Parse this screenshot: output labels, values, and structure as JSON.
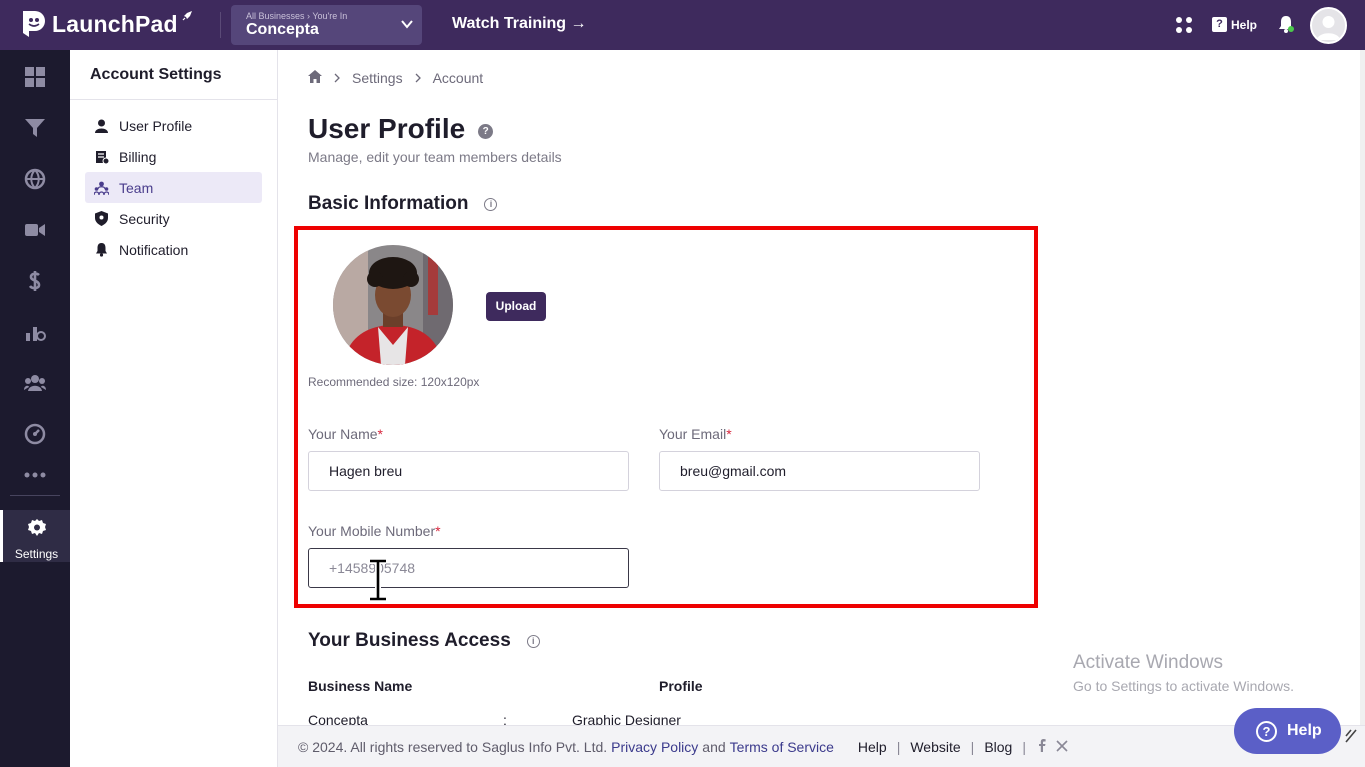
{
  "topbar": {
    "logo_text": "LaunchPad",
    "business_crumb": "All Businesses › You're In",
    "business_name": "Concepta",
    "watch_training": "Watch Training →",
    "help_label": "Help"
  },
  "rail": {
    "items": [
      "dashboard-icon",
      "funnel-icon",
      "globe-icon",
      "video-icon",
      "dollar-icon",
      "analytics-icon",
      "users-icon",
      "gauge-icon",
      "more-icon"
    ],
    "settings_label": "Settings"
  },
  "sidenav": {
    "title": "Account Settings",
    "items": [
      {
        "label": "User Profile",
        "icon": "user-icon"
      },
      {
        "label": "Billing",
        "icon": "billing-icon"
      },
      {
        "label": "Team",
        "icon": "team-icon",
        "active": true
      },
      {
        "label": "Security",
        "icon": "shield-icon"
      },
      {
        "label": "Notification",
        "icon": "bell-icon"
      }
    ]
  },
  "breadcrumb": {
    "home_icon": "home-icon",
    "items": [
      "Settings",
      "Account"
    ]
  },
  "page": {
    "title": "User Profile",
    "title_help": "?",
    "subtitle": "Manage, edit your team members details"
  },
  "basic_info": {
    "title": "Basic Information",
    "info_glyph": "i",
    "upload_label": "Upload",
    "recommended_size": "Recommended size: 120x120px",
    "name_label": "Your Name",
    "name_value": "Hagen breu",
    "email_label": "Your Email",
    "email_value": "breu@gmail.com",
    "mobile_label": "Your Mobile Number",
    "mobile_value": "+1458905748",
    "required_mark": "*"
  },
  "business_access": {
    "title": "Your Business Access",
    "info_glyph": "i",
    "columns": [
      "Business Name",
      "Profile"
    ],
    "rows": [
      {
        "business": "Concepta",
        "separator": ":",
        "profile": "Graphic Designer"
      }
    ]
  },
  "footer": {
    "copyright": "©  2024. All rights reserved to Saglus Info Pvt. Ltd.",
    "privacy": "Privacy Policy",
    "and": "and",
    "terms": "Terms of Service",
    "links": [
      "Help",
      "Website",
      "Blog"
    ],
    "pipe": "|"
  },
  "overlay": {
    "activate_title": "Activate Windows",
    "activate_sub": "Go to Settings to activate Windows.",
    "help_button": "Help",
    "help_q": "?"
  },
  "colors": {
    "topbar": "#3e2a5d",
    "rail": "#1c1a2e",
    "highlight_box": "#ee0000",
    "active_nav_bg": "#ece9f7",
    "help_button": "#5b5fc7"
  }
}
